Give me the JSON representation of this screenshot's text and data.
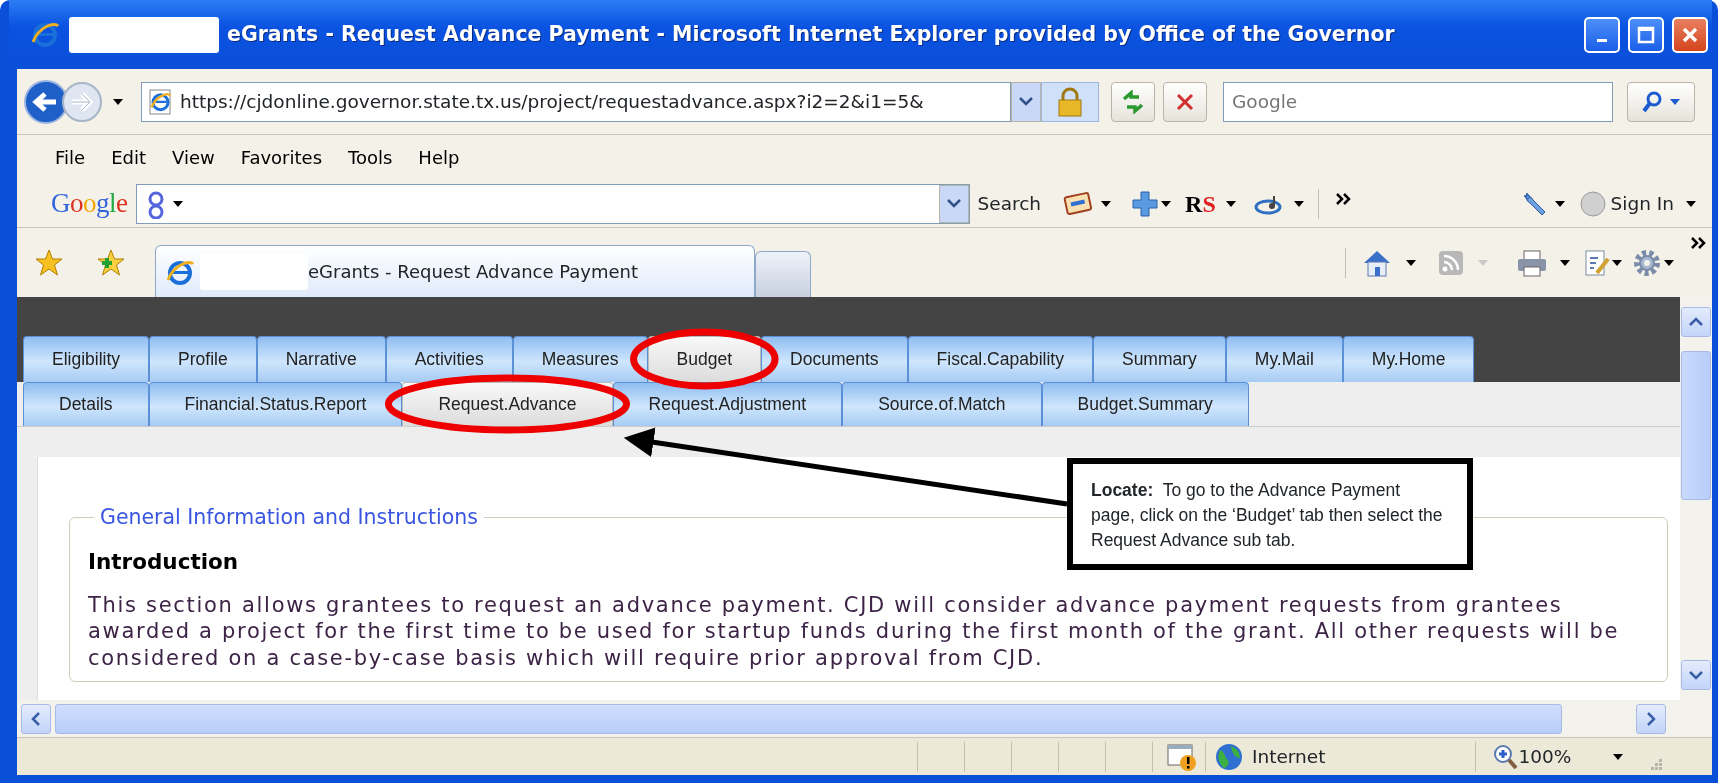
{
  "window": {
    "title": "eGrants - Request Advance Payment - Microsoft Internet Explorer provided by Office of the Governor"
  },
  "address_bar": {
    "url": "https://cjdonline.governor.state.tx.us/project/requestadvance.aspx?i2=2&i1=5&"
  },
  "search_box": {
    "placeholder": "Google"
  },
  "menu": [
    {
      "label": "File"
    },
    {
      "label": "Edit"
    },
    {
      "label": "View"
    },
    {
      "label": "Favorites"
    },
    {
      "label": "Tools"
    },
    {
      "label": "Help"
    }
  ],
  "google_toolbar": {
    "logo": "Google",
    "search_label": "Search",
    "rs_logo": "RS",
    "sign_in": "Sign In"
  },
  "browser_tabs": [
    {
      "label": "eGrants - Request Advance Payment",
      "selected": true
    }
  ],
  "main_tabs": [
    {
      "label": "Eligibility",
      "selected": false
    },
    {
      "label": "Profile",
      "selected": false
    },
    {
      "label": "Narrative",
      "selected": false
    },
    {
      "label": "Activities",
      "selected": false
    },
    {
      "label": "Measures",
      "selected": false
    },
    {
      "label": "Budget",
      "selected": true
    },
    {
      "label": "Documents",
      "selected": false
    },
    {
      "label": "Fiscal.Capability",
      "selected": false
    },
    {
      "label": "Summary",
      "selected": false
    },
    {
      "label": "My.Mail",
      "selected": false
    },
    {
      "label": "My.Home",
      "selected": false
    }
  ],
  "sub_tabs": [
    {
      "label": "Details",
      "selected": false
    },
    {
      "label": "Financial.Status.Report",
      "selected": false
    },
    {
      "label": "Request.Advance",
      "selected": true
    },
    {
      "label": "Request.Adjustment",
      "selected": false
    },
    {
      "label": "Source.of.Match",
      "selected": false
    },
    {
      "label": "Budget.Summary",
      "selected": false
    }
  ],
  "section": {
    "legend": "General Information and Instructions",
    "heading": "Introduction",
    "text": "This section allows grantees to request an advance payment. CJD will consider advance payment requests from grantees\nawarded a project for the first time to be used for startup funds during the first month of the grant. All other requests will be\nconsidered on a case-by-case basis which will require prior approval from CJD."
  },
  "callout": {
    "text": "**Locate:**  To go to the Advance Payment\npage, click on the ‘Budget’ tab then select the\nRequest Advance sub tab."
  },
  "status_bar": {
    "zone": "Internet",
    "zoom": "100%"
  }
}
